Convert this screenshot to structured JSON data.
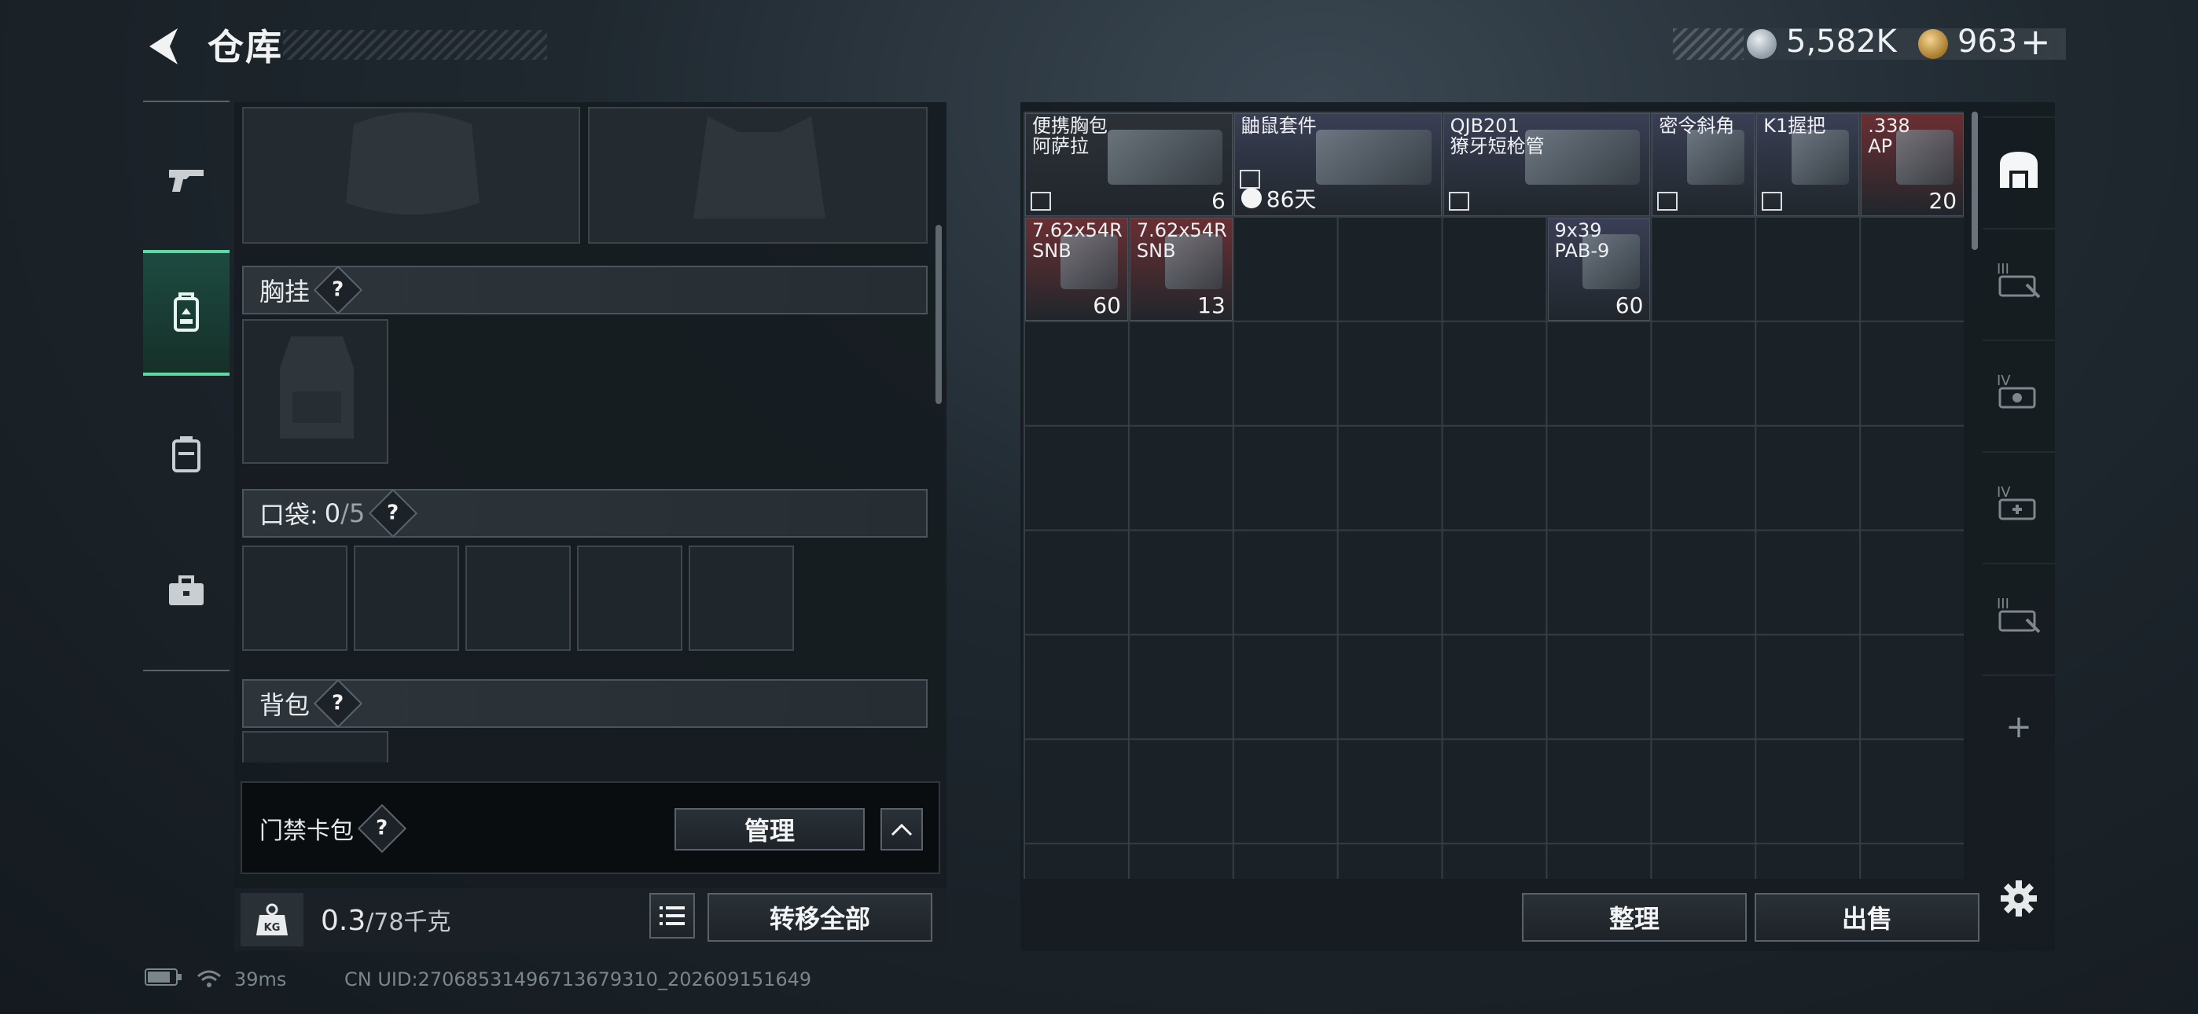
{
  "header": {
    "title": "仓库"
  },
  "currency": {
    "silver": "5,582K",
    "gold": "963",
    "add": "+"
  },
  "tabs": [
    {
      "name": "weapons"
    },
    {
      "name": "gear"
    },
    {
      "name": "backpack"
    },
    {
      "name": "toolbox"
    }
  ],
  "equipment": {
    "chest_rig_label": "胸挂",
    "pockets_label": "口袋:",
    "pockets_used": "0",
    "pockets_total": "/5",
    "backpack_label": "背包",
    "help": "?",
    "keycard_label": "门禁卡包",
    "manage_button": "管理",
    "weight_value": "0.3",
    "weight_capacity": "/78千克",
    "weight_icon": "KG",
    "transfer_all_button": "转移全部"
  },
  "storage": {
    "items": [
      {
        "name": "便携胸包\n阿萨拉",
        "qty": "6",
        "bg": "#2b3137",
        "col": 0,
        "row": 0,
        "w": 2,
        "h": 1,
        "extra": "",
        "icon": "chest-pack-icon"
      },
      {
        "name": "鼬鼠套件",
        "qty": "",
        "bg": "#3a3f55",
        "col": 2,
        "row": 0,
        "w": 2,
        "h": 1,
        "extra": "86天",
        "icon": "rifle-kit-icon"
      },
      {
        "name": "QJB201\n獠牙短枪管",
        "qty": "",
        "bg": "#3a3f55",
        "col": 4,
        "row": 0,
        "w": 2,
        "h": 1,
        "extra": "",
        "icon": "barrel-icon"
      },
      {
        "name": "密令斜角",
        "qty": "",
        "bg": "#3a3f55",
        "col": 6,
        "row": 0,
        "w": 1,
        "h": 1,
        "extra": "",
        "icon": "angled-grip-icon"
      },
      {
        "name": "K1握把",
        "qty": "",
        "bg": "#3a3f55",
        "col": 7,
        "row": 0,
        "w": 1,
        "h": 1,
        "extra": "",
        "icon": "grip-icon"
      },
      {
        "name": ".338\nAP",
        "qty": "20",
        "bg": "#6a2f33",
        "col": 8,
        "row": 0,
        "w": 1,
        "h": 1,
        "extra": "",
        "icon": "ammo-box-icon"
      },
      {
        "name": "7.62x54R\nSNB",
        "qty": "60",
        "bg": "#6a2f33",
        "col": 0,
        "row": 1,
        "w": 1,
        "h": 1,
        "extra": "",
        "icon": "ammo-box-icon"
      },
      {
        "name": "7.62x54R\nSNB",
        "qty": "13",
        "bg": "#6a2f33",
        "col": 1,
        "row": 1,
        "w": 1,
        "h": 1,
        "extra": "",
        "icon": "ammo-box-icon"
      },
      {
        "name": "9x39\nPAB-9",
        "qty": "60",
        "bg": "#3a3f55",
        "col": 5,
        "row": 1,
        "w": 1,
        "h": 1,
        "extra": "",
        "icon": "bullet-icon"
      }
    ],
    "sort_button": "整理",
    "sell_button": "出售"
  },
  "sidebar_right": {
    "tier_labels": [
      "III",
      "IV",
      "IV",
      "III"
    ],
    "add": "+"
  },
  "status": {
    "ping": "39ms",
    "uid": "CN UID:27068531496713679310_202609151649"
  },
  "colors": {
    "accent": "#5fd9a3",
    "rare_purple": "#3a3f55",
    "red_ammo": "#6a2f33"
  }
}
